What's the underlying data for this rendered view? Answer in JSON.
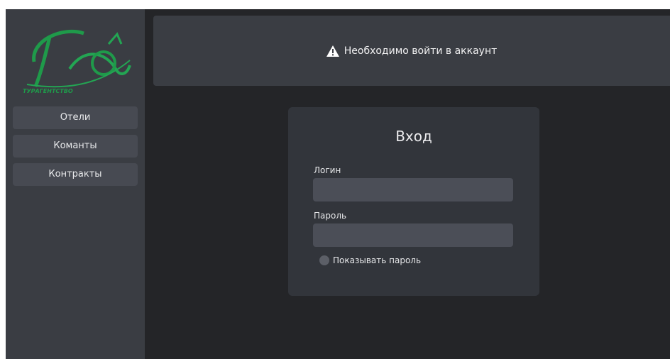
{
  "brand": {
    "logo_text": "Рай",
    "logo_subtext": "ТУРАГЕНТСТВО",
    "accent_color": "#1f9a4a"
  },
  "sidebar": {
    "items": [
      {
        "label": "Отели"
      },
      {
        "label": "Команты"
      },
      {
        "label": "Контракты"
      }
    ]
  },
  "alert": {
    "icon": "warning-icon",
    "message": "Необходимо войти в аккаунт"
  },
  "login": {
    "title": "Вход",
    "login_label": "Логин",
    "login_value": "",
    "password_label": "Пароль",
    "password_value": "",
    "show_password_label": "Показывать пароль"
  }
}
